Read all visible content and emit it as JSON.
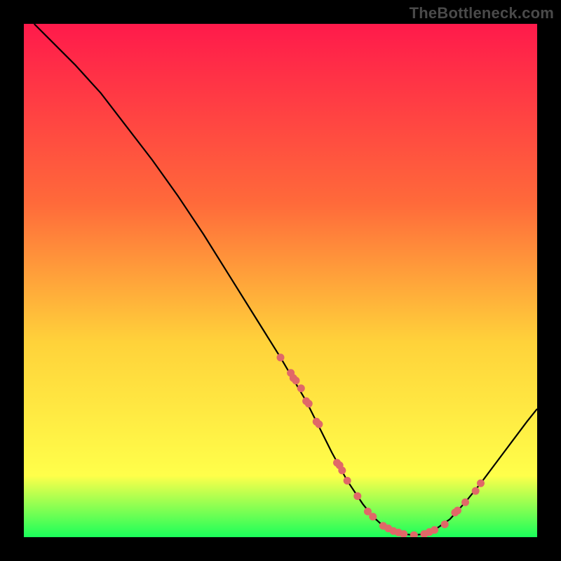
{
  "watermark": "TheBottleneck.com",
  "colors": {
    "bg": "#000000",
    "gradient_top": "#ff1a4b",
    "gradient_mid1": "#ff6a3a",
    "gradient_mid2": "#ffd23a",
    "gradient_mid3": "#ffff4a",
    "gradient_bottom": "#1aff5a",
    "curve": "#000000",
    "dots": "#e06868"
  },
  "chart_data": {
    "type": "line",
    "title": "",
    "xlabel": "",
    "ylabel": "",
    "xlim": [
      0,
      100
    ],
    "ylim": [
      0,
      100
    ],
    "series": [
      {
        "name": "curve",
        "x": [
          2,
          5,
          10,
          15,
          20,
          25,
          30,
          35,
          40,
          45,
          50,
          55,
          57,
          60,
          63,
          66,
          68,
          70,
          72,
          74,
          76,
          78,
          80,
          83,
          86,
          89,
          92,
          95,
          98,
          100
        ],
        "y": [
          100,
          97,
          92,
          86.5,
          80,
          73.5,
          66.5,
          59,
          51,
          43,
          35,
          26.5,
          22.5,
          16.5,
          11,
          6.5,
          4,
          2.2,
          1.2,
          0.6,
          0.4,
          0.6,
          1.4,
          3.5,
          6.8,
          10.5,
          14.5,
          18.5,
          22.5,
          25
        ]
      }
    ],
    "scatter": [
      {
        "name": "dots",
        "x": [
          50,
          52,
          52.5,
          53,
          54,
          55,
          55.5,
          57,
          57.5,
          61,
          61.5,
          62,
          63,
          65,
          67,
          68,
          70,
          71,
          72,
          73,
          74,
          76,
          78,
          79,
          80,
          82,
          84,
          84.5,
          86,
          88,
          89
        ],
        "y": [
          35,
          32,
          31,
          30.5,
          29,
          26.5,
          26,
          22.5,
          22,
          14.5,
          14,
          13,
          11,
          8,
          5,
          4,
          2.2,
          1.7,
          1.2,
          0.9,
          0.6,
          0.4,
          0.6,
          1,
          1.4,
          2.5,
          4.8,
          5.2,
          6.8,
          9,
          10.5
        ]
      }
    ]
  }
}
